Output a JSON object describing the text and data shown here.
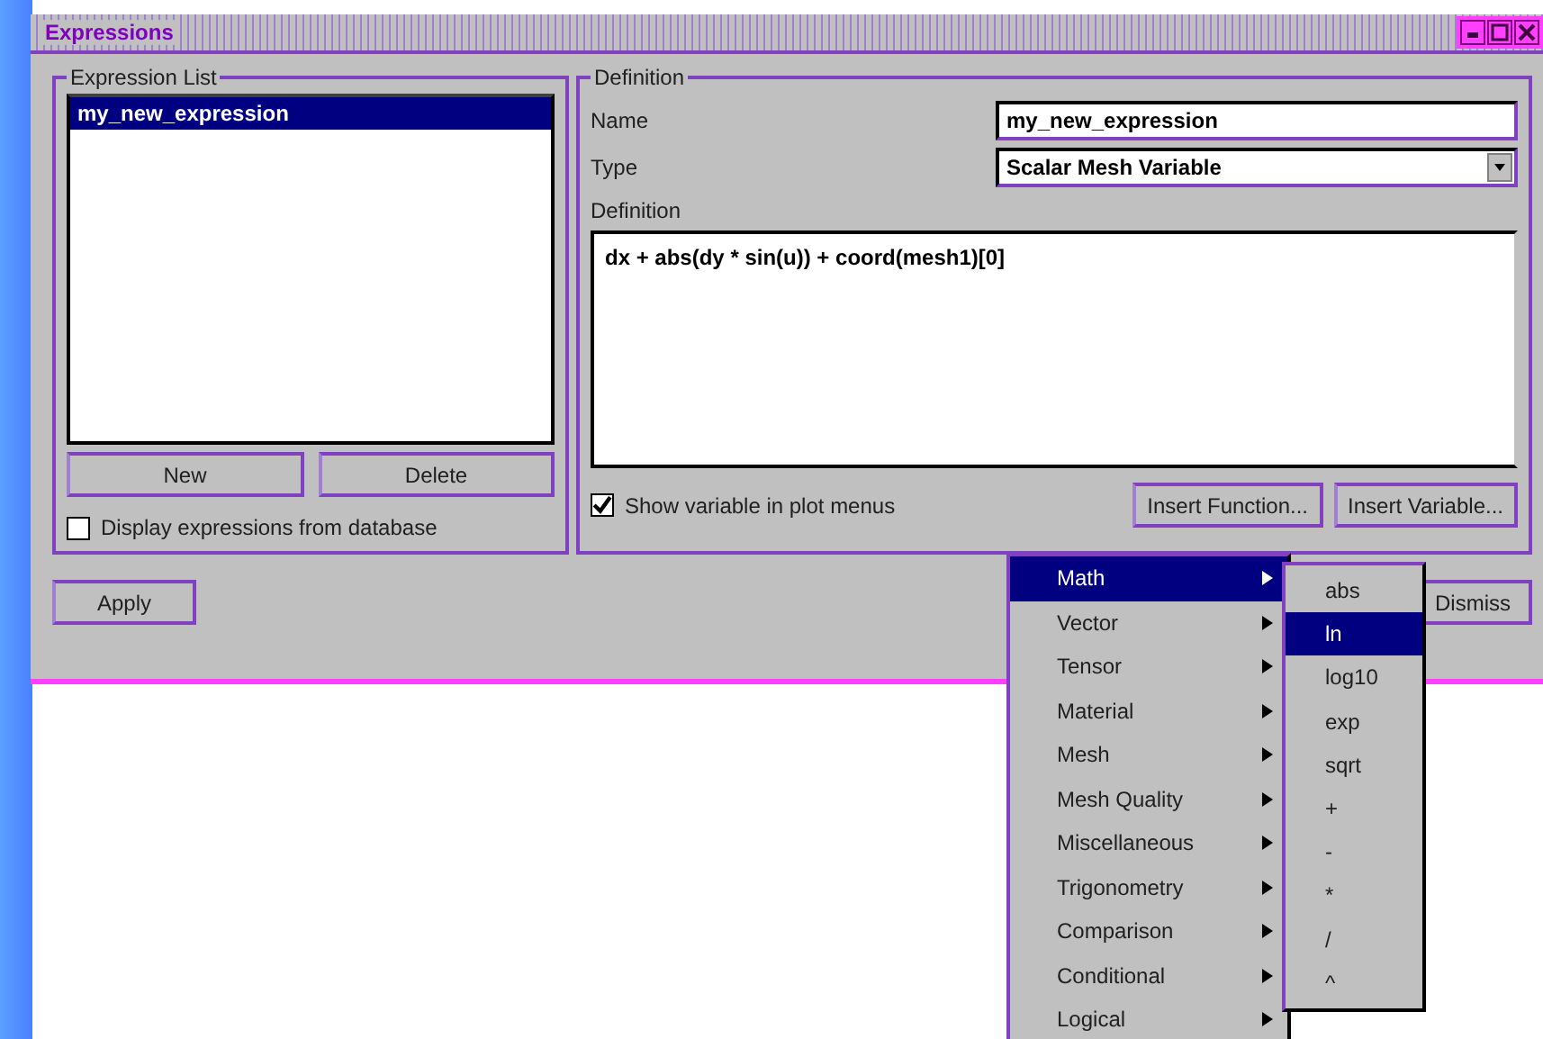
{
  "window": {
    "title": "Expressions"
  },
  "expression_list": {
    "label": "Expression List",
    "items": [
      {
        "text": "my_new_expression",
        "selected": true
      }
    ],
    "buttons": [
      "New",
      "Delete"
    ],
    "display_from_database": {
      "label": "Display expressions from database",
      "checked": false
    }
  },
  "definition": {
    "label": "Definition",
    "name_label": "Name",
    "name_value": "my_new_expression",
    "type_label": "Type",
    "type_value": "Scalar Mesh Variable",
    "definition_label": "Definition",
    "definition_text": "dx + abs(dy * sin(u)) + coord(mesh1)[0]",
    "show_variable": {
      "label": "Show variable in plot menus",
      "checked": true
    },
    "insert_function": "Insert Function...",
    "insert_variable": "Insert Variable..."
  },
  "footer_buttons": [
    "Apply",
    "Dismiss"
  ],
  "function_menu": {
    "items": [
      {
        "label": "Math",
        "selected": true
      },
      {
        "label": "Vector",
        "selected": false
      },
      {
        "label": "Tensor",
        "selected": false
      },
      {
        "label": "Material",
        "selected": false
      },
      {
        "label": "Mesh",
        "selected": false
      },
      {
        "label": "Mesh Quality",
        "selected": false
      },
      {
        "label": "Miscellaneous",
        "selected": false
      },
      {
        "label": "Trigonometry",
        "selected": false
      },
      {
        "label": "Comparison",
        "selected": false
      },
      {
        "label": "Conditional",
        "selected": false
      },
      {
        "label": "Logical",
        "selected": false
      }
    ]
  },
  "math_submenu": {
    "items": [
      {
        "label": "abs",
        "selected": false
      },
      {
        "label": "ln",
        "selected": true
      },
      {
        "label": "log10",
        "selected": false
      },
      {
        "label": "exp",
        "selected": false
      },
      {
        "label": "sqrt",
        "selected": false
      },
      {
        "label": "+",
        "selected": false
      },
      {
        "label": "-",
        "selected": false
      },
      {
        "label": "*",
        "selected": false
      },
      {
        "label": "/",
        "selected": false
      },
      {
        "label": "^",
        "selected": false
      }
    ]
  }
}
